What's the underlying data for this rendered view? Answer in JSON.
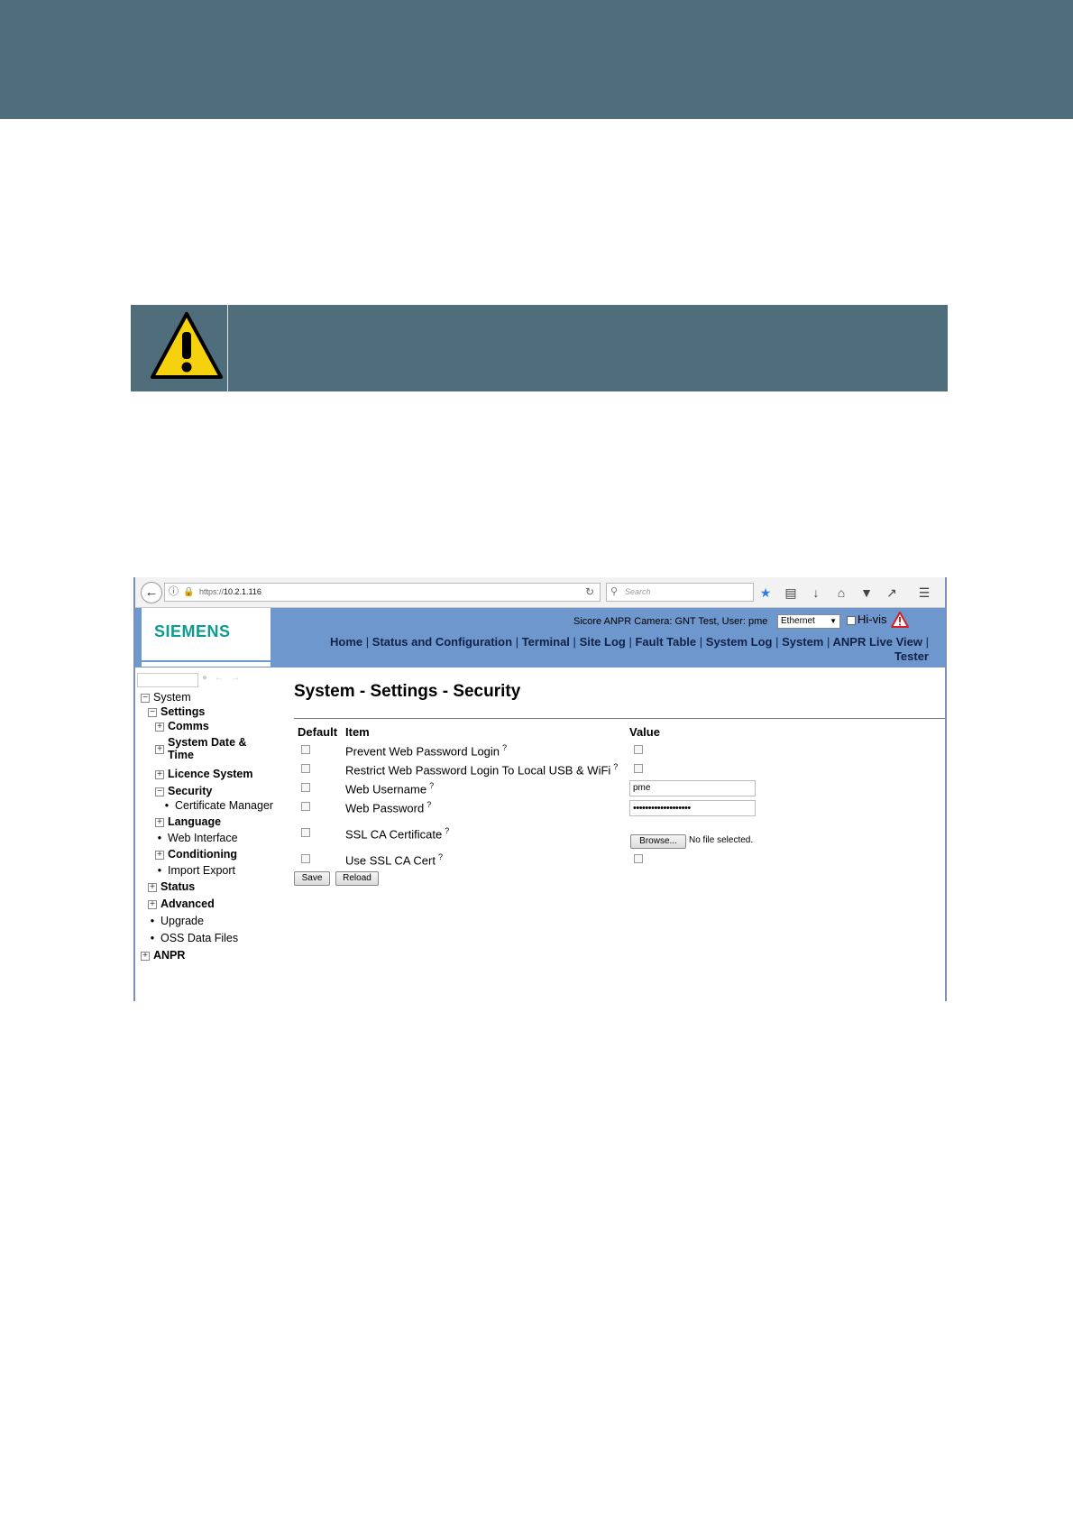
{
  "browser": {
    "url_prefix": "https://",
    "url_host": "10.2.1.116",
    "search_placeholder": "Search"
  },
  "header": {
    "logo": "SIEMENS",
    "camera_info": "Sicore ANPR Camera: GNT Test, User: pme",
    "interface_value": "Ethernet",
    "hivis_label": "Hi-vis",
    "nav": [
      "Home",
      "Status and Configuration",
      "Terminal",
      "Site Log",
      "Fault Table",
      "System Log",
      "System",
      "ANPR Live View"
    ],
    "nav_last": "Tester"
  },
  "tree": {
    "system": "System",
    "settings": "Settings",
    "comms": "Comms",
    "system_date_1": "System Date &",
    "system_date_2": "Time",
    "licence": "Licence System",
    "security": "Security",
    "certificate_manager": "Certificate Manager",
    "language": "Language",
    "web_interface": "Web Interface",
    "conditioning": "Conditioning",
    "import_export": "Import Export",
    "status": "Status",
    "advanced": "Advanced",
    "upgrade": "Upgrade",
    "oss_data_files": "OSS Data Files",
    "anpr": "ANPR"
  },
  "content": {
    "title": "System - Settings - Security",
    "col_default": "Default",
    "col_item": "Item",
    "col_value": "Value",
    "rows": [
      {
        "label": "Prevent Web Password Login",
        "help": "?"
      },
      {
        "label": "Restrict Web Password Login To Local USB & WiFi",
        "help": "?"
      },
      {
        "label": "Web Username",
        "help": "?",
        "value": "pme"
      },
      {
        "label": "Web Password",
        "help": "?",
        "value": "•••••••••••••••••••"
      },
      {
        "label": "SSL CA Certificate",
        "help": "?"
      },
      {
        "label": "Use SSL CA Cert",
        "help": "?"
      }
    ],
    "browse_label": "Browse...",
    "file_status": "No file selected.",
    "save_label": "Save",
    "reload_label": "Reload"
  }
}
